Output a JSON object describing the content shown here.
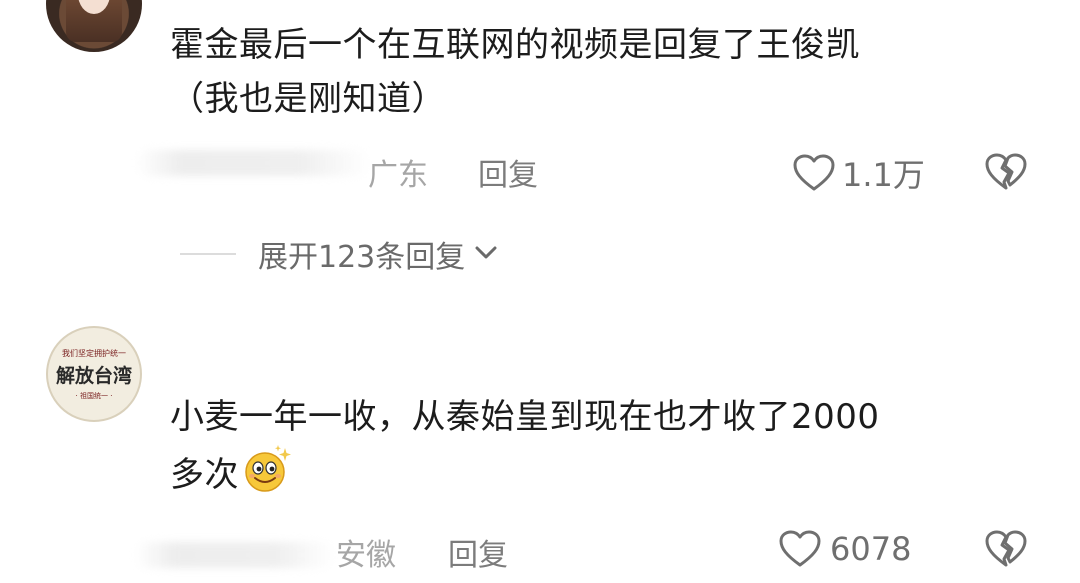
{
  "comments": [
    {
      "avatar": "avatar-photo",
      "text_line1": "霍金最后一个在互联网的视频是回复了王俊凯",
      "text_line2": "（我也是刚知道）",
      "location": "广东",
      "reply_label": "回复",
      "likes": "1.1万"
    },
    {
      "avatar": "avatar-seal",
      "avatar_seal_top": "我们坚定拥护统一",
      "avatar_seal_main": "解放台湾",
      "avatar_seal_bottom": "· 祖国统一 ·",
      "text_line1": "小麦一年一收，从秦始皇到现在也才收了2000",
      "text_line2": "多次",
      "location": "安徽",
      "reply_label": "回复",
      "likes": "6078"
    }
  ],
  "expand": {
    "label": "展开123条回复"
  },
  "icons": {
    "like": "heart-outline-icon",
    "dislike": "broken-heart-icon",
    "expand": "chevron-down-icon",
    "emoji": "sparkle-smile-emoji-icon"
  },
  "colors": {
    "text": "#1c1c1c",
    "meta": "#a6a6a6",
    "icon": "#6f6f6f"
  }
}
